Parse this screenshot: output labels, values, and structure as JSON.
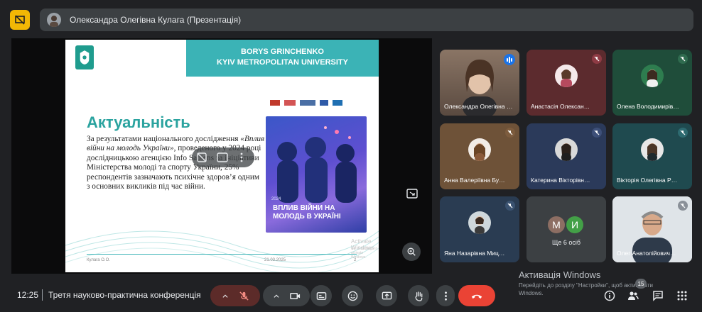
{
  "presenter_bar": {
    "name": "Олександра Олегівна Кулага (Презентація)"
  },
  "slide": {
    "university_line1": "BORYS GRINCHENKO",
    "university_line2": "KYIV METROPOLITAN UNIVERSITY",
    "title": "Актуальність",
    "body_pre": "За результатами національного дослідження ",
    "body_italic": "«Вплив війни на молодь України»",
    "body_post": ", проведеного у 2024 році дослідницькою агенцією Info Sapiens за ініціативи Міністерства молоді та спорту України, 25% респондентів зазначають психічне здоров’я одним з основних викликів під час війни.",
    "poster_year": "2024",
    "poster_title": "ВПЛИВ ВІЙНИ НА МОЛОДЬ В УКРАЇНІ",
    "footer_author": "Кулага О.О.",
    "footer_date": "21.03.2025",
    "footer_page": "2",
    "activate_small_1": "Activate Windows",
    "activate_small_2": "Go to Settings to activate Windows."
  },
  "participants": [
    {
      "name": "Олександра Олегівна Кулага",
      "speaking": true,
      "bg": "#6b5a4e"
    },
    {
      "name": "Анастасія Олексан…",
      "bg": "#5c2b2e"
    },
    {
      "name": "Олена Володимирів…",
      "bg": "#1f4d3a"
    },
    {
      "name": "Анна Валеріївна Бу…",
      "bg": "#6e5238"
    },
    {
      "name": "Катерина Вікторівн…",
      "bg": "#2b3a5a"
    },
    {
      "name": "Вікторія Олегівна Р…",
      "bg": "#1f4a4f"
    },
    {
      "name": "Яна Назарівна Миц…",
      "bg": "#2a3c52"
    },
    {
      "name": "Олег Анатолійович…",
      "bg": "#cfd6de"
    }
  ],
  "more_tile": {
    "avatar_1": "М",
    "avatar_2": "И",
    "label": "Ще 6 осіб"
  },
  "activate_windows": {
    "title": "Активація Windows",
    "subtitle": "Перейдіть до розділу \"Настройки\", щоб активувати Windows."
  },
  "bottom_bar": {
    "time": "12:25",
    "meeting_title": "Третя науково-практична конференція"
  },
  "people_count": "15",
  "colors": {
    "accent_yellow": "#f2b705",
    "teal": "#3bb3b6",
    "end_call_red": "#ea4335",
    "avatar_m": "#8d6e63",
    "avatar_i": "#43a047"
  }
}
